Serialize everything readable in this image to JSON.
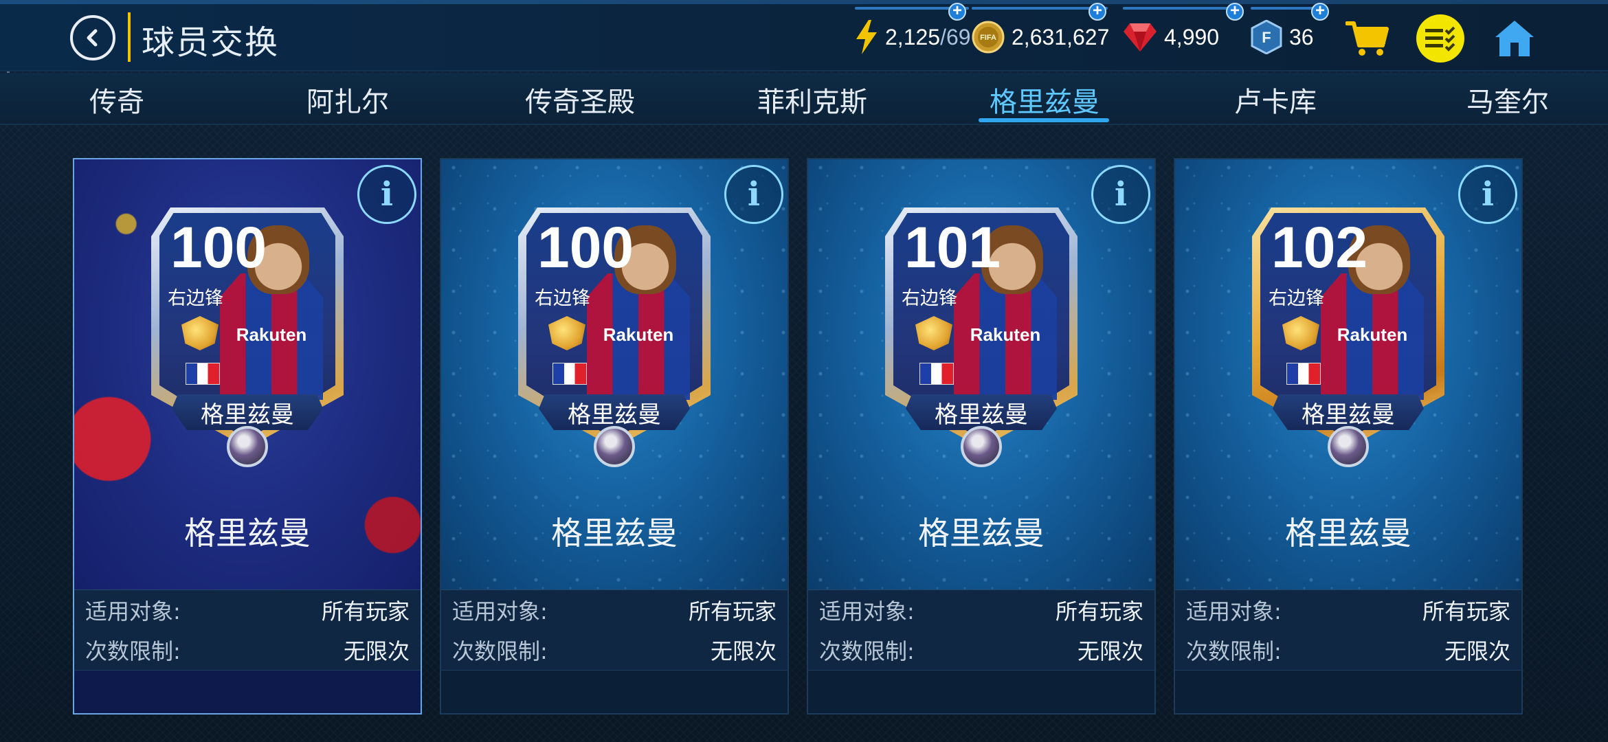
{
  "header": {
    "title": "球员交换",
    "energy": {
      "value": "2,125",
      "max": "/69"
    },
    "coins": "2,631,627",
    "gems": "4,990",
    "fifa_points": "36"
  },
  "tabs": [
    {
      "label": "传奇",
      "active": false
    },
    {
      "label": "阿扎尔",
      "active": false
    },
    {
      "label": "传奇圣殿",
      "active": false
    },
    {
      "label": "菲利克斯",
      "active": false
    },
    {
      "label": "格里兹曼",
      "active": true
    },
    {
      "label": "卢卡库",
      "active": false
    },
    {
      "label": "马奎尔",
      "active": false
    }
  ],
  "cards": [
    {
      "rating": "100",
      "position": "右边锋",
      "plate_name": "格里兹曼",
      "sponsor": "Rakuten",
      "name": "格里兹曼",
      "audience_label": "适用对象:",
      "audience_value": "所有玩家",
      "limit_label": "次数限制:",
      "limit_value": "无限次"
    },
    {
      "rating": "100",
      "position": "右边锋",
      "plate_name": "格里兹曼",
      "sponsor": "Rakuten",
      "name": "格里兹曼",
      "audience_label": "适用对象:",
      "audience_value": "所有玩家",
      "limit_label": "次数限制:",
      "limit_value": "无限次"
    },
    {
      "rating": "101",
      "position": "右边锋",
      "plate_name": "格里兹曼",
      "sponsor": "Rakuten",
      "name": "格里兹曼",
      "audience_label": "适用对象:",
      "audience_value": "所有玩家",
      "limit_label": "次数限制:",
      "limit_value": "无限次"
    },
    {
      "rating": "102",
      "position": "右边锋",
      "plate_name": "格里兹曼",
      "sponsor": "Rakuten",
      "name": "格里兹曼",
      "audience_label": "适用对象:",
      "audience_value": "所有玩家",
      "limit_label": "次数限制:",
      "limit_value": "无限次"
    }
  ],
  "colors": {
    "accent": "#2fa6ee",
    "active_tab": "#5ec8ff",
    "title_separator": "#f2c400",
    "cart": "#f5c400",
    "tasks": "#f2e600"
  },
  "icons": {
    "back": "back-arrow-icon",
    "energy": "lightning-icon",
    "coins": "fifa-coin-icon",
    "gems": "gem-icon",
    "fifa_points": "fifa-points-icon",
    "cart": "shopping-cart-icon",
    "tasks": "checklist-icon",
    "home": "home-icon",
    "info": "info-icon"
  }
}
